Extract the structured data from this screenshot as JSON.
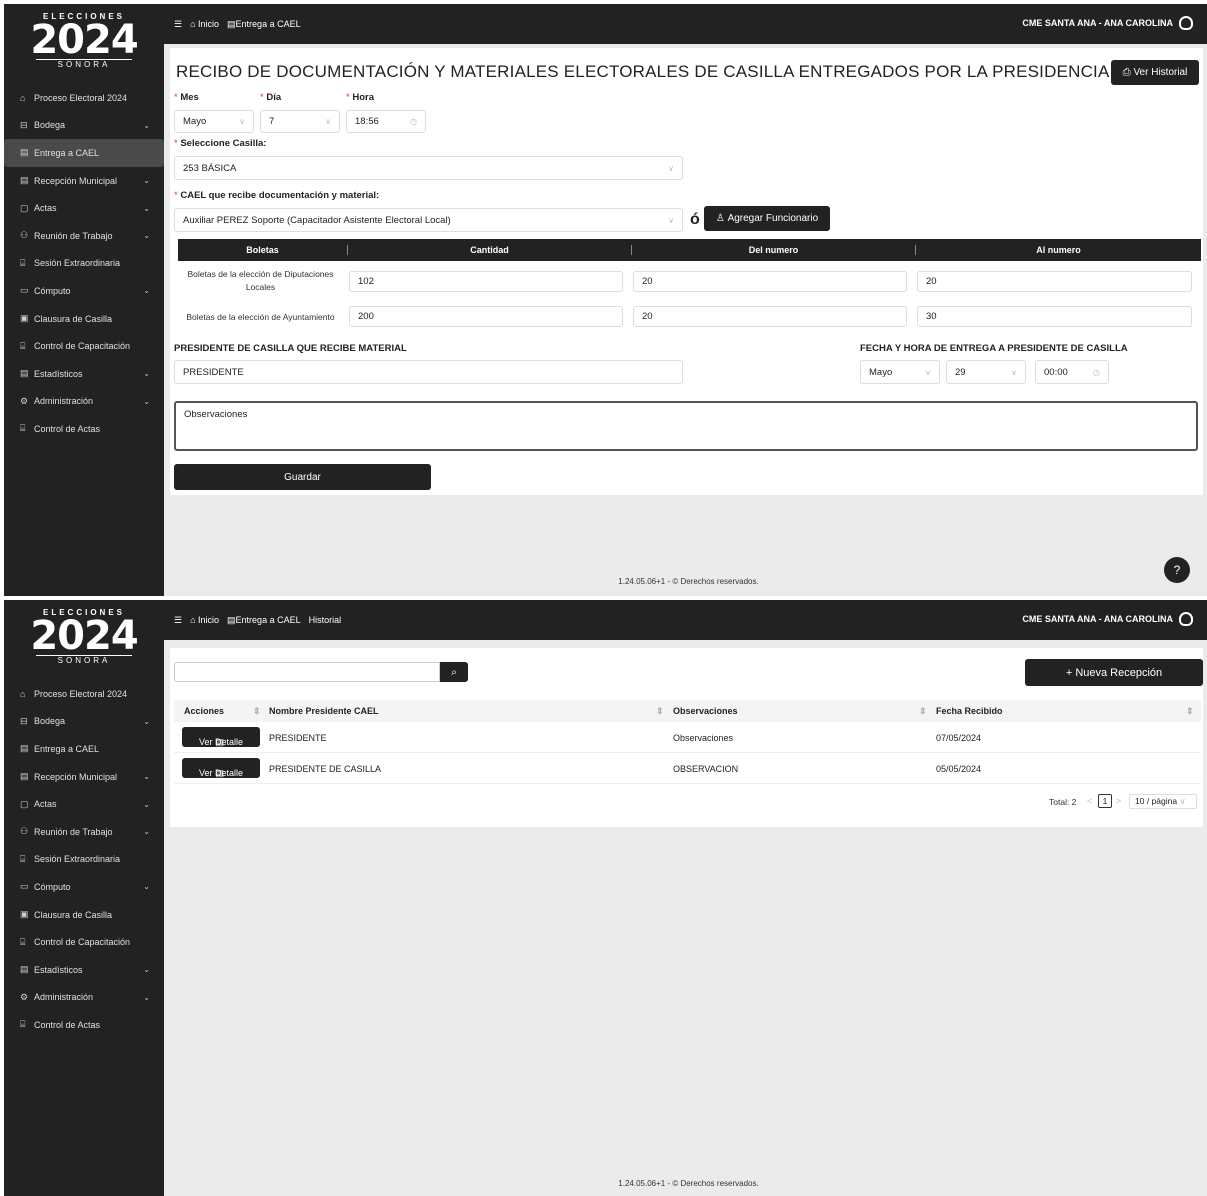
{
  "app": {
    "logo_top": "ELECCIONES",
    "logo_year": "2024",
    "logo_bottom": "SONORA",
    "user": "CME SANTA ANA - ANA CAROLINA"
  },
  "sidebar": {
    "items": [
      {
        "label": "Proceso Electoral 2024",
        "icon": "home-icon",
        "glyph": "⌂"
      },
      {
        "label": "Bodega",
        "icon": "warehouse-icon",
        "glyph": "⊟"
      },
      {
        "label": "Entrega a CAEL",
        "icon": "document-icon",
        "glyph": "▤"
      },
      {
        "label": "Recepción Municipal",
        "icon": "document-icon",
        "glyph": "▤"
      },
      {
        "label": "Actas",
        "icon": "file-icon",
        "glyph": "▢"
      },
      {
        "label": "Reunión de Trabajo",
        "icon": "group-icon",
        "glyph": "⚇"
      },
      {
        "label": "Sesión Extraordinaria",
        "icon": "meeting-icon",
        "glyph": "⌸"
      },
      {
        "label": "Cómputo",
        "icon": "monitor-icon",
        "glyph": "▭"
      },
      {
        "label": "Clausura de Casilla",
        "icon": "clipboard-icon",
        "glyph": "▣"
      },
      {
        "label": "Control de Capacitación",
        "icon": "meeting-icon",
        "glyph": "⌸"
      },
      {
        "label": "Estadísticos",
        "icon": "stats-icon",
        "glyph": "▤"
      },
      {
        "label": "Administración",
        "icon": "gear-icon",
        "glyph": "⚙"
      },
      {
        "label": "Control de Actas",
        "icon": "meeting-icon",
        "glyph": "⌸"
      }
    ]
  },
  "screen1": {
    "breadcrumb": [
      "Inicio",
      "Entrega a CAEL"
    ],
    "title": "RECIBO DE DOCUMENTACIÓN Y MATERIALES ELECTORALES DE CASILLA ENTREGADOS POR LA PRESIDENCIA AL CAE",
    "ver_historial": "Ver Historial",
    "mes_label": "Mes",
    "dia_label": "Día",
    "hora_label": "Hora",
    "mes_value": "Mayo",
    "dia_value": "7",
    "hora_value": "18:56",
    "casilla_label": "Seleccione Casilla:",
    "casilla_value": "253 BÁSICA",
    "cael_label": "CAEL que recibe documentación y material:",
    "cael_value": "Auxiliar PEREZ Soporte (Capacitador Asistente Electoral Local)",
    "or_text": "ó",
    "agregar_label": "Agregar Funcionario",
    "table_headers": [
      "Boletas",
      "Cantidad",
      "Del numero",
      "Al numero"
    ],
    "rows": [
      {
        "label": "Boletas de la elección de Diputaciones Locales",
        "cantidad": "102",
        "del": "20",
        "al": "20"
      },
      {
        "label": "Boletas de la elección de Ayuntamiento",
        "cantidad": "200",
        "del": "20",
        "al": "30"
      }
    ],
    "presidente_label": "PRESIDENTE DE CASILLA QUE RECIBE MATERIAL",
    "presidente_value": "PRESIDENTE",
    "fecha_label": "FECHA Y HORA DE ENTREGA A PRESIDENTE DE CASILLA",
    "fecha_mes": "Mayo",
    "fecha_dia": "29",
    "fecha_hora": "00:00",
    "observaciones_placeholder": "Observaciones",
    "guardar": "Guardar",
    "footer": "1.24.05.06+1 - © Derechos reservados."
  },
  "screen2": {
    "breadcrumb": [
      "Inicio",
      "Entrega a CAEL",
      "Historial"
    ],
    "nueva": "Nueva Recepción",
    "columns": [
      "Acciones",
      "Nombre Presidente CAEL",
      "Observaciones",
      "Fecha Recibido"
    ],
    "rows": [
      {
        "action": "Ver Detalle",
        "nombre": "PRESIDENTE",
        "obs": "Observaciones",
        "fecha": "07/05/2024"
      },
      {
        "action": "Ver Detalle",
        "nombre": "PRESIDENTE DE CASILLA",
        "obs": "OBSERVACION",
        "fecha": "05/05/2024"
      }
    ],
    "total": "Total: 2",
    "page": "1",
    "page_size": "10 / página",
    "footer": "1.24.05.06+1 - © Derechos reservados."
  }
}
